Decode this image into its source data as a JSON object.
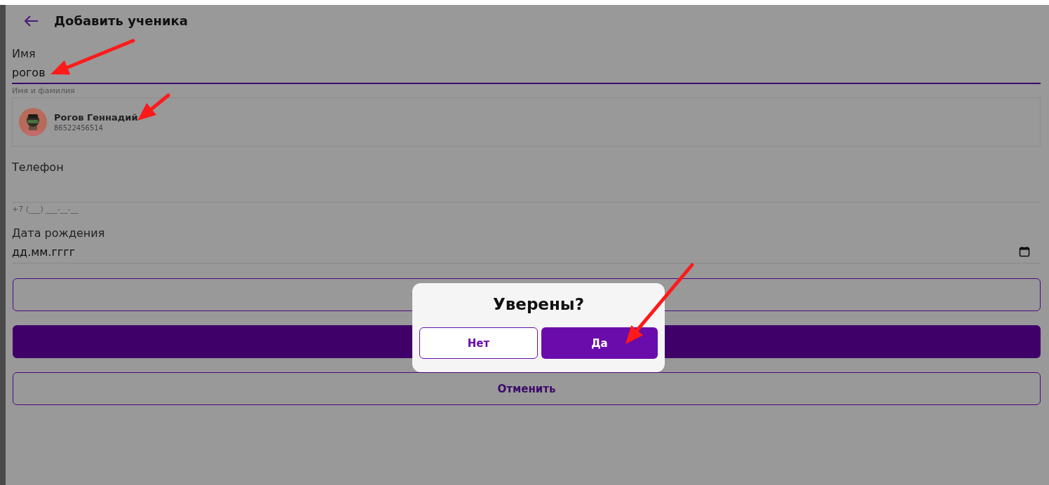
{
  "header": {
    "title": "Добавить ученика"
  },
  "name_field": {
    "label": "Имя",
    "value": "рогов",
    "helper": "Имя и фамилия",
    "focused": true
  },
  "suggestions": [
    {
      "name": "Рогов Геннадий",
      "phone": "86522456514",
      "kind": "picture"
    }
  ],
  "phone_field": {
    "label": "Телефон",
    "helper": "+7 (___) ___-__-__"
  },
  "birth_field": {
    "label": "Дата рождения",
    "placeholder": "дд.мм.гггг"
  },
  "actions": [
    {
      "kind": "outline"
    },
    {
      "kind": "filled"
    },
    {
      "kind": "outline",
      "label": "Отменить"
    }
  ],
  "dialog": {
    "title": "Уверены?",
    "buttons": [
      {
        "label": "Нет",
        "kind": "secondary"
      },
      {
        "label": "Да",
        "kind": "primary"
      }
    ]
  },
  "annotations": [
    {
      "kind": "arrow"
    },
    {
      "kind": "arrow"
    },
    {
      "kind": "arrow"
    }
  ]
}
